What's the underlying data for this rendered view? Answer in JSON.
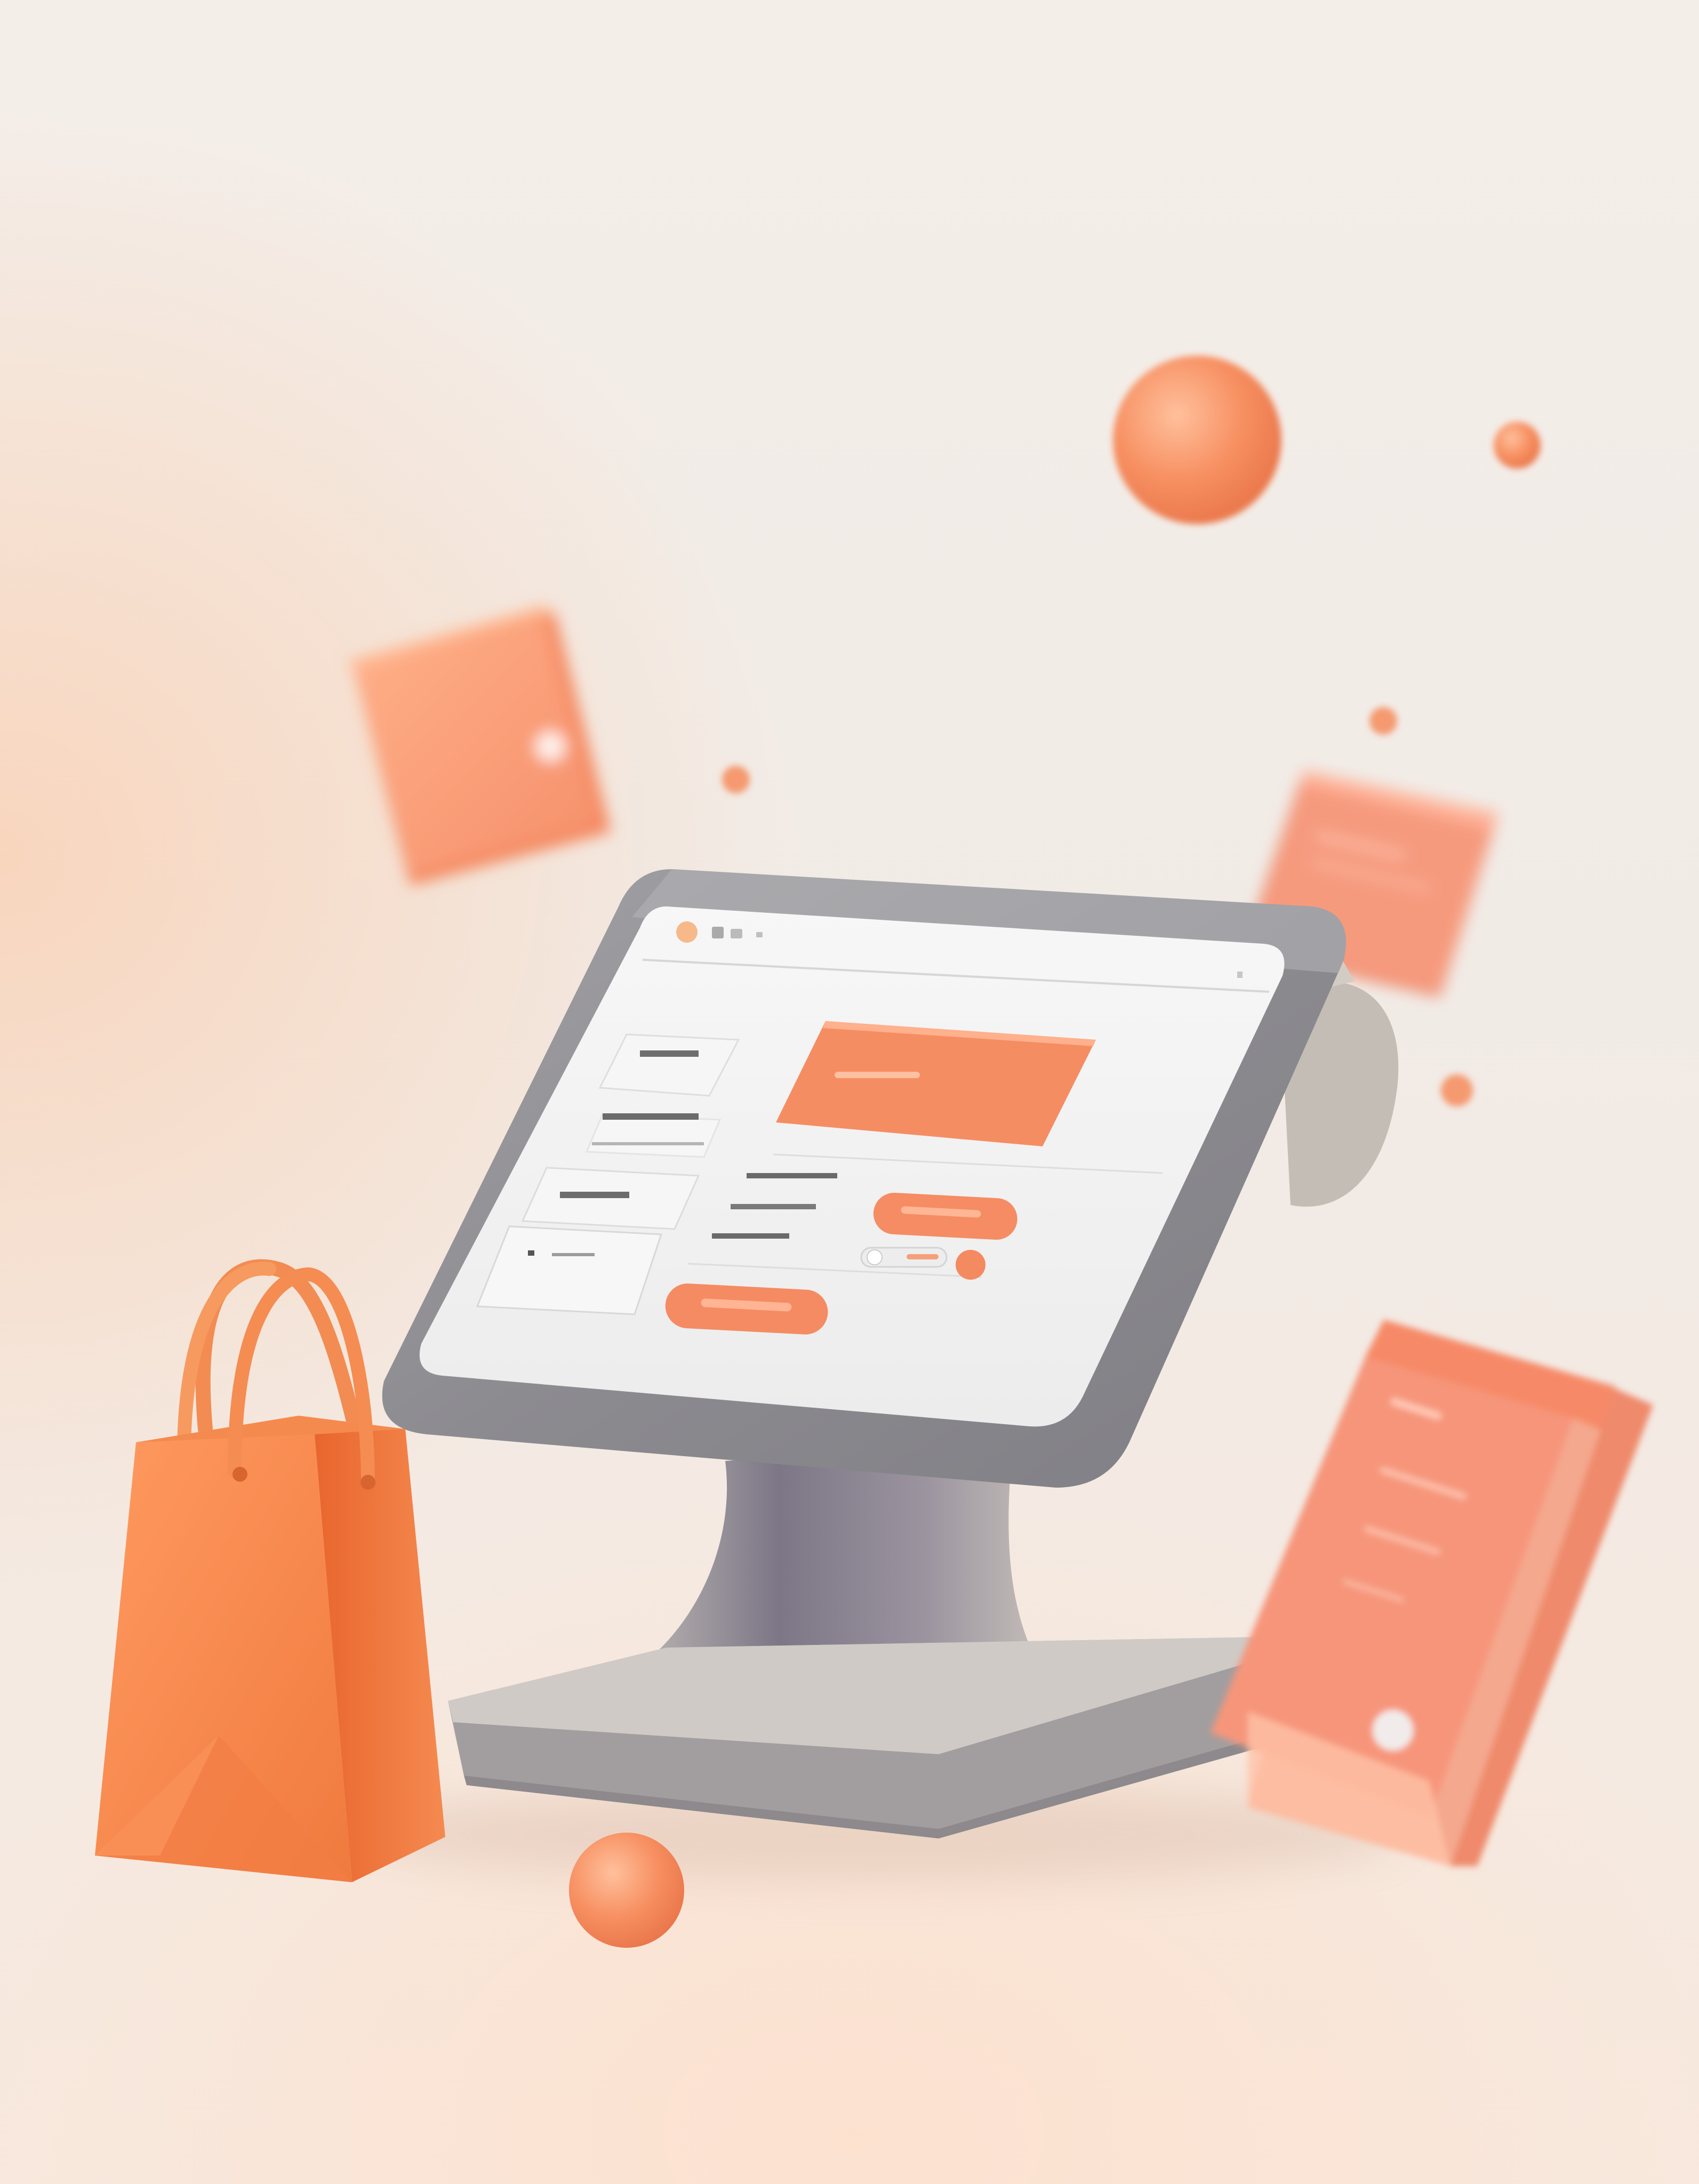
{
  "scene": {
    "description_free": true,
    "accent": "#f48a5a",
    "accent_light": "#ffb38a",
    "device_frame": "#8f8f95",
    "screen_bg": "#f3f3f3",
    "background": "#f2ece7"
  },
  "icons": [
    "shopping-bag-icon",
    "card-icon",
    "sphere-icon"
  ]
}
